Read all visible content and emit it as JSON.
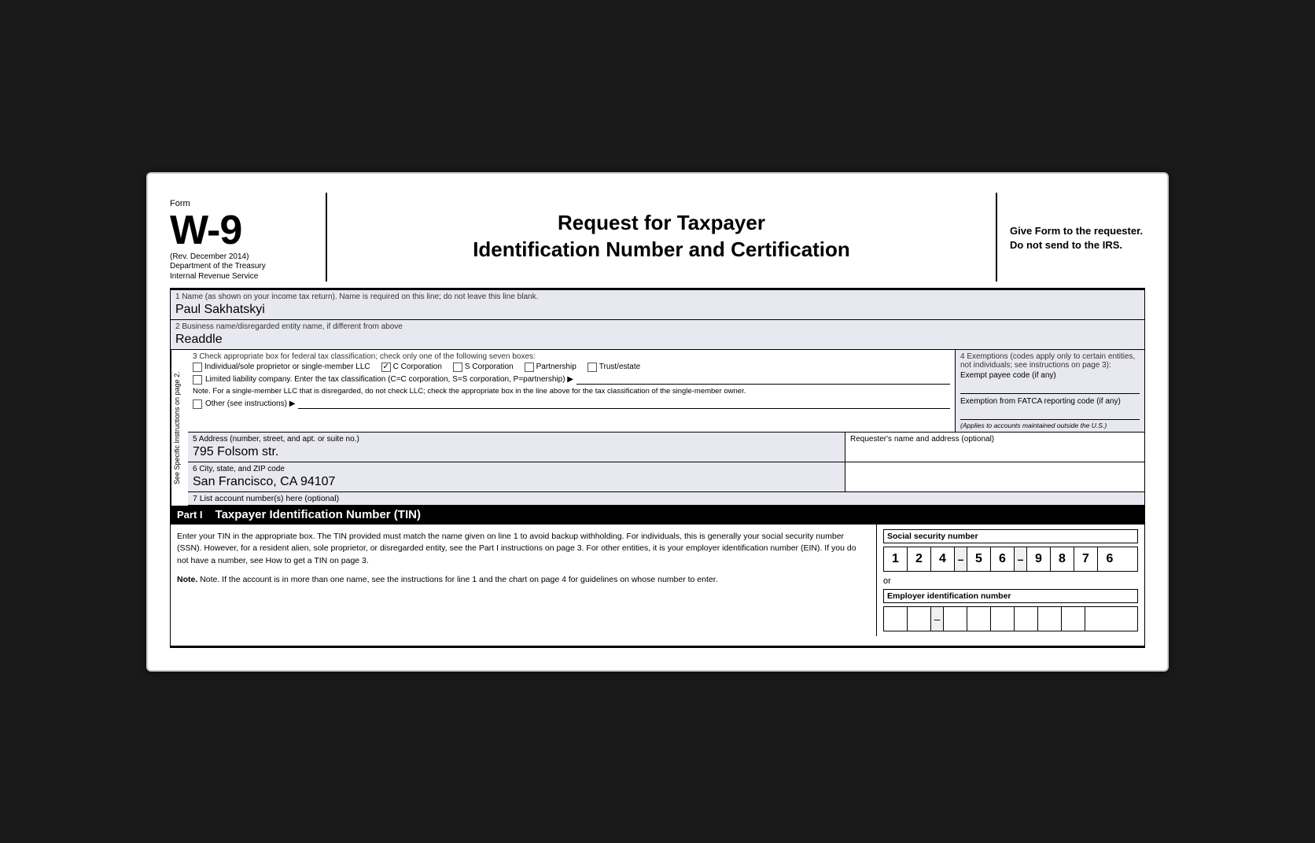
{
  "header": {
    "form_label": "Form",
    "form_number": "W-9",
    "rev": "(Rev. December 2014)",
    "dept1": "Department of the Treasury",
    "dept2": "Internal Revenue Service",
    "title_line1": "Request for Taxpayer",
    "title_line2": "Identification Number and Certification",
    "give_form": "Give Form to the requester. Do not send to the IRS."
  },
  "fields": {
    "field1_label": "1  Name (as shown on your income tax return). Name is required on this line; do not leave this line blank.",
    "field1_value": "Paul Sakhatskyi",
    "field2_label": "2  Business name/disregarded entity name, if different from above",
    "field2_value": "Readdle",
    "field3_label": "3  Check appropriate box for federal tax classification; check only one of the following seven boxes:",
    "checkbox_individual_label": "Individual/sole proprietor or single-member LLC",
    "checkbox_individual_checked": false,
    "checkbox_ccorp_label": "C Corporation",
    "checkbox_ccorp_checked": true,
    "checkbox_scorp_label": "S Corporation",
    "checkbox_scorp_checked": false,
    "checkbox_partnership_label": "Partnership",
    "checkbox_partnership_checked": false,
    "checkbox_trust_label": "Trust/estate",
    "checkbox_trust_checked": false,
    "llc_label": "Limited liability company. Enter the tax classification (C=C corporation, S=S corporation, P=partnership) ▶",
    "note_text": "Note. For a single-member LLC that is disregarded, do not check LLC; check the appropriate box in the line above for the tax classification of the single-member owner.",
    "other_label": "Other (see instructions) ▶",
    "field4_label": "4  Exemptions (codes apply only to certain entities, not individuals; see instructions on page 3):",
    "exempt_payee_label": "Exempt payee code (if any)",
    "fatca_label": "Exemption from FATCA reporting code (if any)",
    "fatca_note": "(Applies to accounts maintained outside the U.S.)",
    "field5_label": "5  Address (number, street, and apt. or suite no.)",
    "field5_value": "795 Folsom str.",
    "requester_label": "Requester's name and address (optional)",
    "field6_label": "6  City, state, and ZIP code",
    "field6_value": "San Francisco, CA 94107",
    "field7_label": "7  List account number(s) here (optional)",
    "part1_label": "Part I",
    "part1_title": "Taxpayer Identification Number (TIN)",
    "part1_body": "Enter your TIN in the appropriate box. The TIN provided must match the name given on line 1 to avoid backup withholding. For individuals, this is generally your social security number (SSN). However, for a resident alien, sole proprietor, or disregarded entity, see the Part I instructions on page 3. For other entities, it is your employer identification number (EIN). If you do not have a number, see How to get a TIN on page 3.",
    "part1_note": "Note. If the account is in more than one name, see the instructions for line 1 and the chart on page 4 for guidelines on whose number to enter.",
    "ssn_label": "Social security number",
    "ssn_digits": [
      "1",
      "2",
      "4",
      "",
      "5",
      "6",
      "",
      "9",
      "8",
      "7",
      "6"
    ],
    "or_text": "or",
    "ein_label": "Employer identification number",
    "ein_digits": [
      "",
      "",
      "",
      "",
      "",
      "",
      "",
      "",
      ""
    ],
    "sidebar_text": "See Specific Instructions on page 2."
  }
}
